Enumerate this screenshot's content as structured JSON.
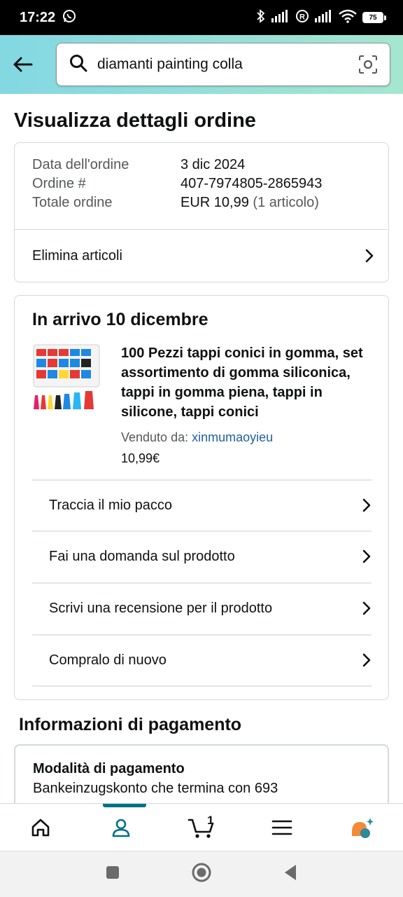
{
  "status_bar": {
    "time": "17:22",
    "battery": "75"
  },
  "search": {
    "value": "diamanti painting colla"
  },
  "page": {
    "title": "Visualizza dettagli ordine"
  },
  "order_summary": {
    "date_label": "Data dell'ordine",
    "date_value": "3 dic 2024",
    "order_label": "Ordine #",
    "order_value": "407-7974805-2865943",
    "total_label": "Totale ordine",
    "total_value": "EUR 10,99",
    "total_items": "(1 articolo)",
    "delete_items_label": "Elimina articoli"
  },
  "shipment": {
    "arrival": "In arrivo 10 dicembre",
    "product_title": "100 Pezzi tappi conici in gomma, set assortimento di gomma siliconica, tappi in gomma piena, tappi in silicone, tappi conici",
    "seller_label": "Venduto da:",
    "seller_name": "xinmumaoyieu",
    "price": "10,99€",
    "actions": [
      "Traccia il mio pacco",
      "Fai una domanda sul prodotto",
      "Scrivi una recensione per il prodotto",
      "Compralo di nuovo"
    ]
  },
  "payment": {
    "section_title": "Informazioni di pagamento",
    "method_label": "Modalità di pagamento",
    "method_value": "Bankeinzugskonto che termina con 693"
  },
  "bottom_nav": {
    "cart_count": "1",
    "items": [
      "home-icon",
      "account-icon",
      "cart-icon",
      "menu-icon",
      "rufus-icon"
    ],
    "active": "account-icon"
  },
  "colors": {
    "header_gradient_start": "#83d8e2",
    "header_gradient_end": "#a5e6cf",
    "link": "#2162a1",
    "active_nav": "#007185",
    "rufus_orange": "#f3893a",
    "rufus_teal": "#2d8a99"
  }
}
